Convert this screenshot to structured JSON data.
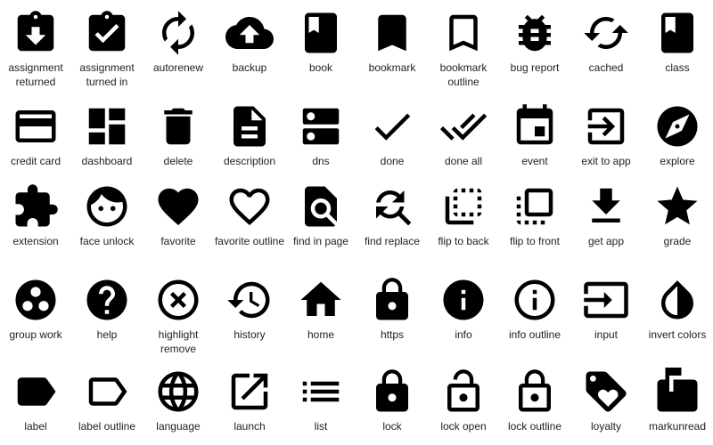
{
  "icon_color": "#000000",
  "rows": [
    [
      {
        "icon": "assignment-returned",
        "label": "assignment returned"
      },
      {
        "icon": "assignment-turned-in",
        "label": "assignment turned in"
      },
      {
        "icon": "autorenew",
        "label": "autorenew"
      },
      {
        "icon": "backup",
        "label": "backup"
      },
      {
        "icon": "book",
        "label": "book"
      },
      {
        "icon": "bookmark",
        "label": "bookmark"
      },
      {
        "icon": "bookmark-outline",
        "label": "bookmark outline"
      },
      {
        "icon": "bug-report",
        "label": "bug report"
      },
      {
        "icon": "cached",
        "label": "cached"
      },
      {
        "icon": "class",
        "label": "class"
      }
    ],
    [
      {
        "icon": "credit-card",
        "label": "credit card"
      },
      {
        "icon": "dashboard",
        "label": "dashboard"
      },
      {
        "icon": "delete",
        "label": "delete"
      },
      {
        "icon": "description",
        "label": "description"
      },
      {
        "icon": "dns",
        "label": "dns"
      },
      {
        "icon": "done",
        "label": "done"
      },
      {
        "icon": "done-all",
        "label": "done all"
      },
      {
        "icon": "event",
        "label": "event"
      },
      {
        "icon": "exit-to-app",
        "label": "exit to app"
      },
      {
        "icon": "explore",
        "label": "explore"
      }
    ],
    [
      {
        "icon": "extension",
        "label": "extension"
      },
      {
        "icon": "face-unlock",
        "label": "face unlock"
      },
      {
        "icon": "favorite",
        "label": "favorite"
      },
      {
        "icon": "favorite-outline",
        "label": "favorite outline"
      },
      {
        "icon": "find-in-page",
        "label": "find in page"
      },
      {
        "icon": "find-replace",
        "label": "find replace"
      },
      {
        "icon": "flip-to-back",
        "label": "flip to back"
      },
      {
        "icon": "flip-to-front",
        "label": "flip to front"
      },
      {
        "icon": "get-app",
        "label": "get app"
      },
      {
        "icon": "grade",
        "label": "grade"
      }
    ],
    [
      {
        "icon": "group-work",
        "label": "group work"
      },
      {
        "icon": "help",
        "label": "help"
      },
      {
        "icon": "highlight-remove",
        "label": "highlight remove"
      },
      {
        "icon": "history",
        "label": "history"
      },
      {
        "icon": "home",
        "label": "home"
      },
      {
        "icon": "https",
        "label": "https"
      },
      {
        "icon": "info",
        "label": "info"
      },
      {
        "icon": "info-outline",
        "label": "info outline"
      },
      {
        "icon": "input",
        "label": "input"
      },
      {
        "icon": "invert-colors",
        "label": "invert colors"
      }
    ],
    [
      {
        "icon": "label",
        "label": "label"
      },
      {
        "icon": "label-outline",
        "label": "label outline"
      },
      {
        "icon": "language",
        "label": "language"
      },
      {
        "icon": "launch",
        "label": "launch"
      },
      {
        "icon": "list",
        "label": "list"
      },
      {
        "icon": "lock",
        "label": "lock"
      },
      {
        "icon": "lock-open",
        "label": "lock open"
      },
      {
        "icon": "lock-outline",
        "label": "lock outline"
      },
      {
        "icon": "loyalty",
        "label": "loyalty"
      },
      {
        "icon": "markunread",
        "label": "markunread"
      }
    ]
  ]
}
